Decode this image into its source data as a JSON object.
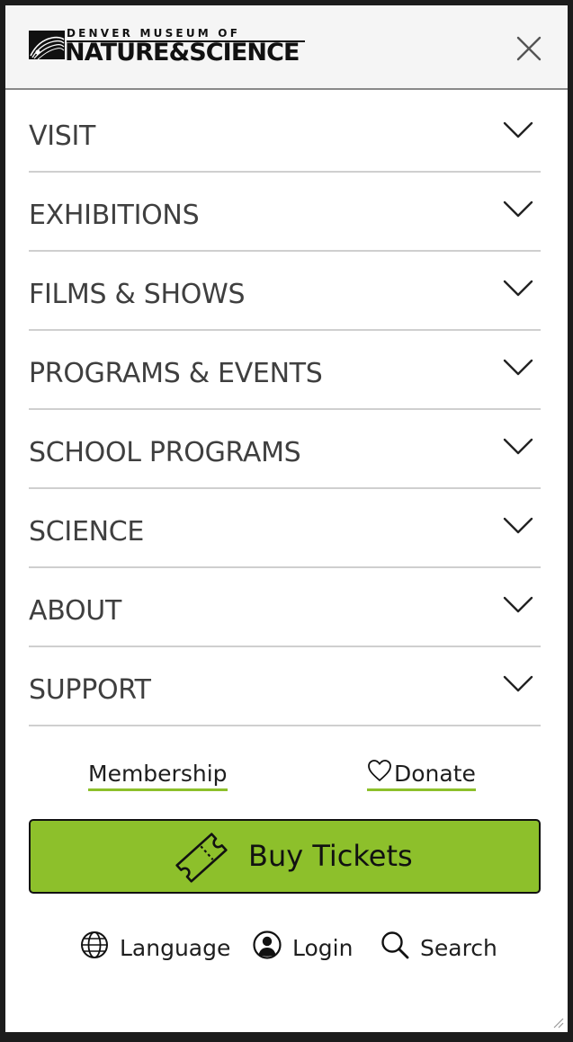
{
  "header": {
    "logo_top": "DENVER MUSEUM OF",
    "logo_main": "NATURE&SCIENCE",
    "close_icon": "close-icon"
  },
  "nav": {
    "items": [
      {
        "label": "VISIT"
      },
      {
        "label": "EXHIBITIONS"
      },
      {
        "label": "FILMS & SHOWS"
      },
      {
        "label": "PROGRAMS & EVENTS"
      },
      {
        "label": "SCHOOL PROGRAMS"
      },
      {
        "label": "SCIENCE"
      },
      {
        "label": "ABOUT"
      },
      {
        "label": "SUPPORT"
      }
    ],
    "expand_icon": "chevron-down-icon"
  },
  "quick_links": {
    "membership": "Membership",
    "donate": "Donate",
    "donate_icon": "heart-icon"
  },
  "buy_tickets": {
    "label": "Buy Tickets",
    "icon": "ticket-icon"
  },
  "utility": {
    "language": "Language",
    "login": "Login",
    "search": "Search"
  },
  "colors": {
    "accent_green": "#8dc02b",
    "text_gray": "#3f3f3f",
    "divider": "#cfcfcf"
  }
}
